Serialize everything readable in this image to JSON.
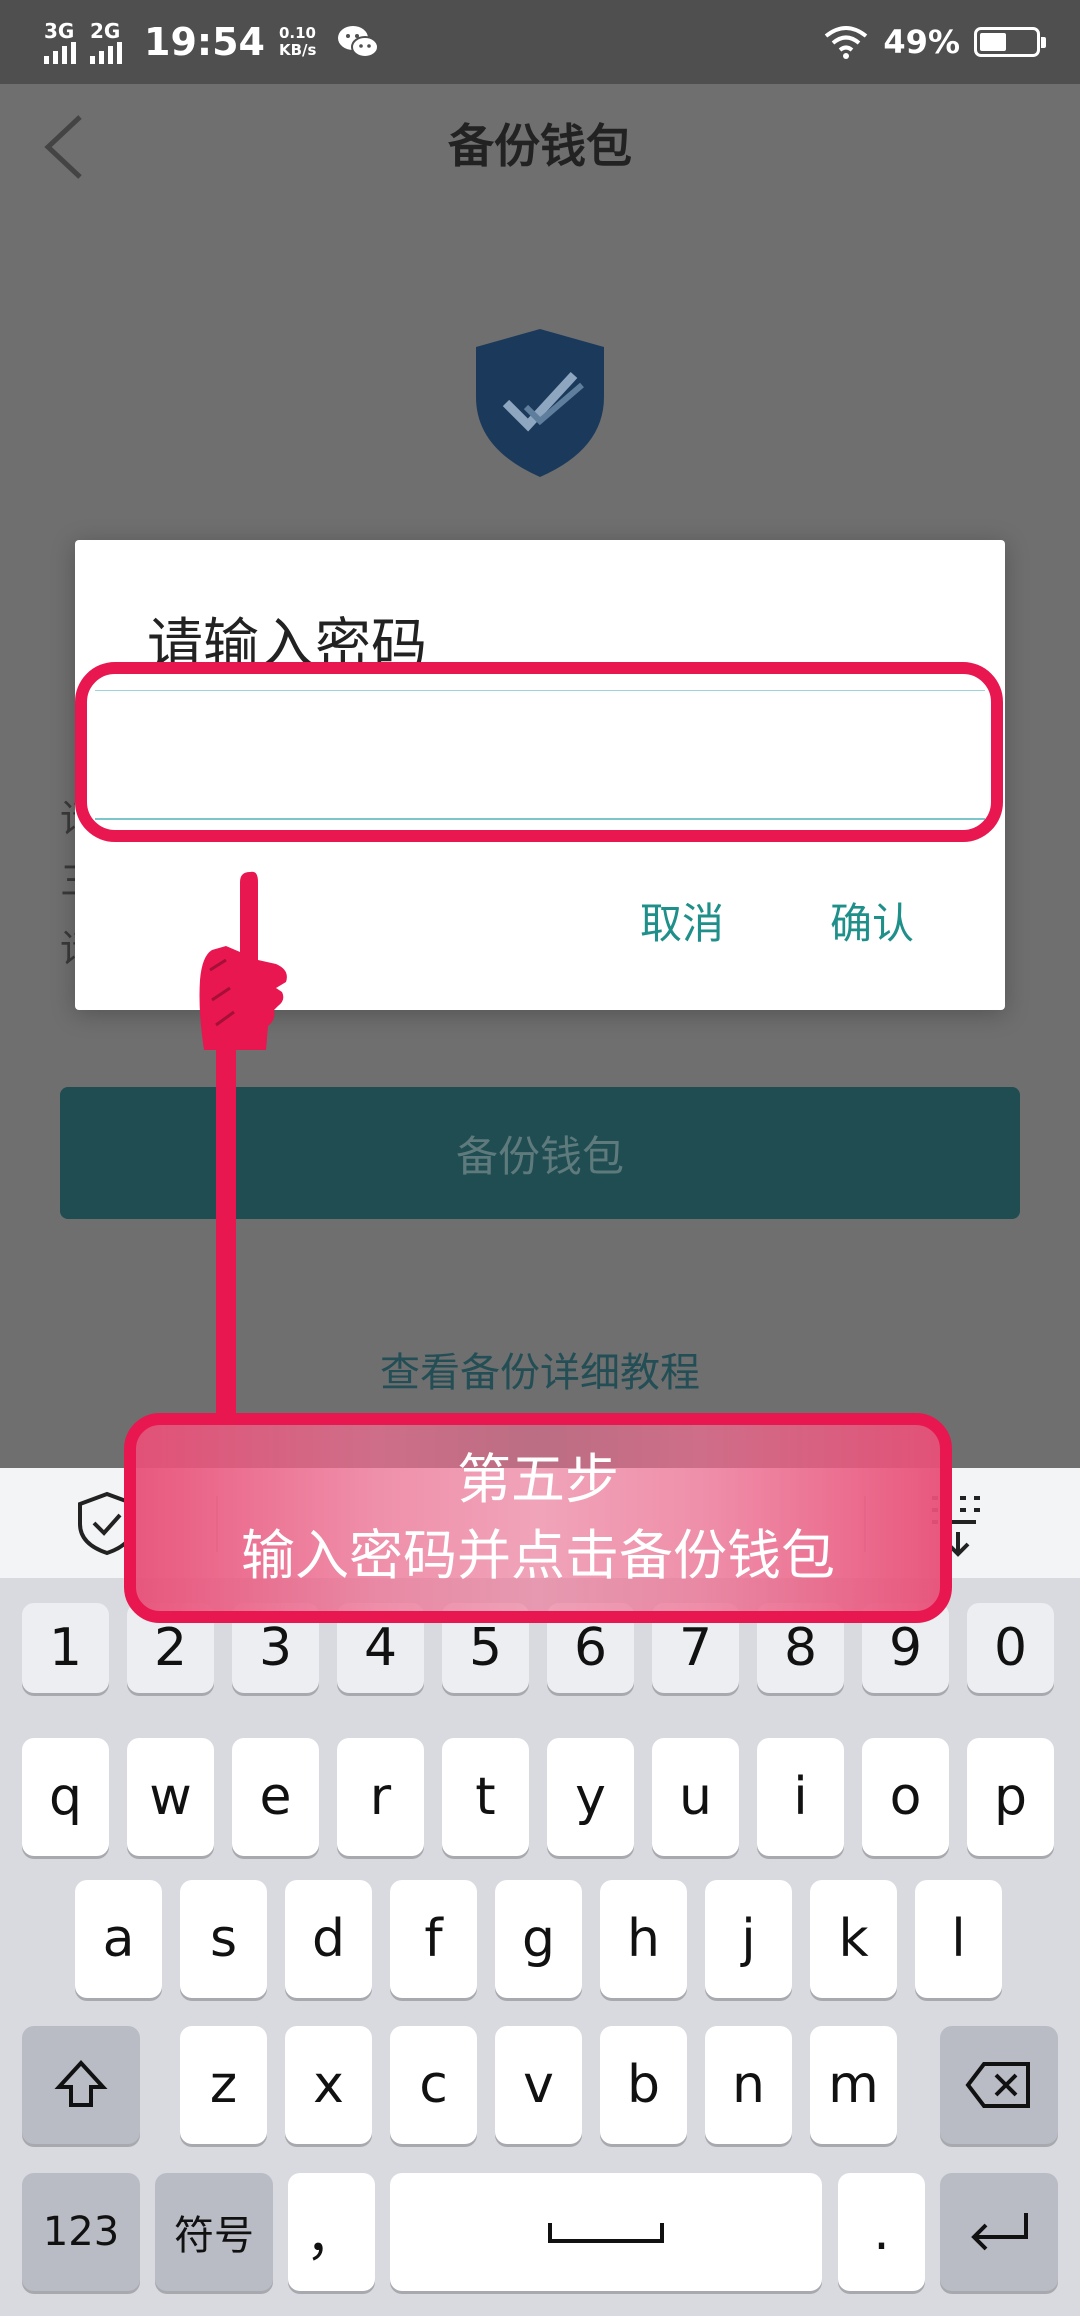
{
  "status_bar": {
    "net1": "3G",
    "net2": "2G",
    "time": "19:54",
    "speed_value": "0.10",
    "speed_unit": "KB/s",
    "battery": "49%",
    "battery_level": 0.49
  },
  "header": {
    "title": "备份钱包"
  },
  "dialog": {
    "title": "请输入密码",
    "password_value": "",
    "cancel_label": "取消",
    "confirm_label": "确认"
  },
  "page": {
    "backup_button_label": "备份钱包",
    "tutorial_link": "查看备份详细教程"
  },
  "tip": {
    "step": "第五步",
    "text": "输入密码并点击备份钱包"
  },
  "keyboard": {
    "row_numbers": [
      "1",
      "2",
      "3",
      "4",
      "5",
      "6",
      "7",
      "8",
      "9",
      "0"
    ],
    "row1": [
      "q",
      "w",
      "e",
      "r",
      "t",
      "y",
      "u",
      "i",
      "o",
      "p"
    ],
    "row2": [
      "a",
      "s",
      "d",
      "f",
      "g",
      "h",
      "j",
      "k",
      "l"
    ],
    "row3": [
      "z",
      "x",
      "c",
      "v",
      "b",
      "n",
      "m"
    ],
    "numbers_key": "123",
    "symbols_key": "符号",
    "comma_key": "，",
    "period_key": "."
  },
  "colors": {
    "accent_teal": "#1f8f8a",
    "highlight_red": "#e8174f",
    "shield_blue": "#1b3a5b"
  }
}
